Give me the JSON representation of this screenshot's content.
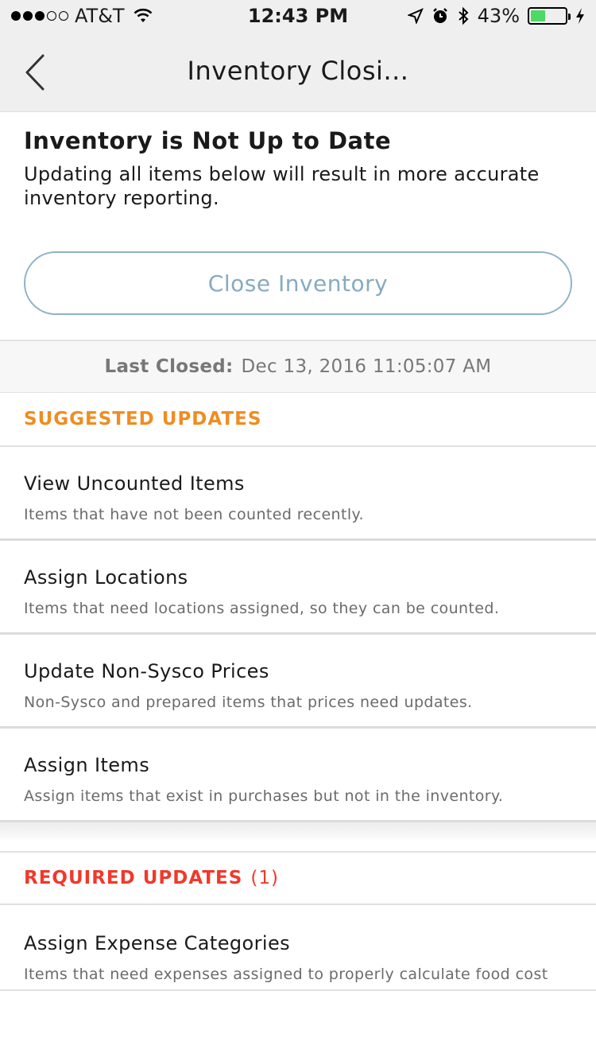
{
  "status_bar": {
    "carrier": "AT&T",
    "time": "12:43 PM",
    "battery_percent": "43%",
    "battery_level": 0.43,
    "signal_bars": 3,
    "signal_total": 5
  },
  "nav": {
    "title": "Inventory Closi..."
  },
  "intro": {
    "title": "Inventory is Not Up to Date",
    "text": "Updating all items below will result in more accurate inventory reporting."
  },
  "close_button": {
    "label": "Close Inventory"
  },
  "last_closed": {
    "label": "Last Closed:",
    "value": "Dec 13, 2016 11:05:07 AM"
  },
  "suggested": {
    "header": "SUGGESTED UPDATES",
    "items": [
      {
        "title": "View Uncounted Items",
        "subtitle": "Items that have not been counted recently."
      },
      {
        "title": "Assign Locations",
        "subtitle": "Items that need locations assigned, so they can be counted."
      },
      {
        "title": "Update Non-Sysco Prices",
        "subtitle": "Non-Sysco and prepared items that prices need updates."
      },
      {
        "title": "Assign Items",
        "subtitle": "Assign items that exist in purchases but not in the inventory."
      }
    ]
  },
  "required": {
    "header": "REQUIRED UPDATES",
    "count": "(1)",
    "items": [
      {
        "title": "Assign Expense Categories",
        "subtitle": "Items that need expenses assigned to properly calculate food cost"
      }
    ]
  },
  "colors": {
    "suggested_header": "#ef8d22",
    "required_header": "#f0392b",
    "close_button_border": "#8fb3c5",
    "battery": "#4cd964"
  }
}
